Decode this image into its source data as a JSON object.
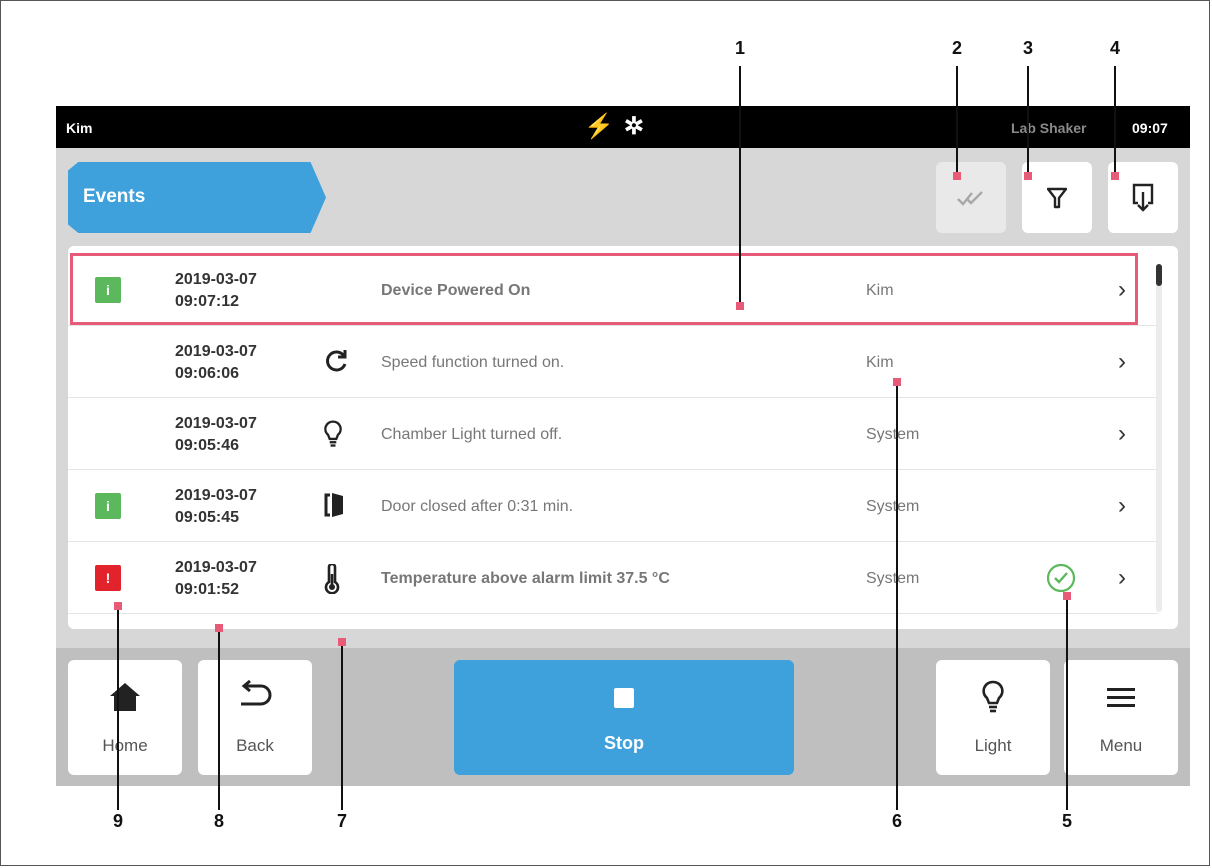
{
  "statusbar": {
    "user": "Kim",
    "device": "Lab Shaker",
    "time": "09:07"
  },
  "header": {
    "title": "Events"
  },
  "toolbar": {
    "acknowledge": {
      "icon": "double-check-icon",
      "enabled": false
    },
    "filter": {
      "icon": "filter-icon"
    },
    "export": {
      "icon": "export-icon"
    }
  },
  "events": [
    {
      "badge": "info",
      "date": "2019-03-07",
      "time": "09:07:12",
      "icon": "",
      "message": "Device Powered On",
      "bold": true,
      "user": "Kim",
      "acknowledged": false
    },
    {
      "badge": "",
      "date": "2019-03-07",
      "time": "09:06:06",
      "icon": "rotation-icon",
      "message": "Speed function turned on.",
      "bold": false,
      "user": "Kim",
      "acknowledged": false
    },
    {
      "badge": "",
      "date": "2019-03-07",
      "time": "09:05:46",
      "icon": "lightbulb-icon",
      "message": "Chamber Light turned off.",
      "bold": false,
      "user": "System",
      "acknowledged": false
    },
    {
      "badge": "info",
      "date": "2019-03-07",
      "time": "09:05:45",
      "icon": "door-icon",
      "message": "Door closed after 0:31 min.",
      "bold": false,
      "user": "System",
      "acknowledged": false
    },
    {
      "badge": "alarm",
      "date": "2019-03-07",
      "time": "09:01:52",
      "icon": "thermometer-icon",
      "message": "Temperature above alarm limit 37.5 °C",
      "bold": true,
      "user": "System",
      "acknowledged": true
    }
  ],
  "bottom": {
    "home": "Home",
    "back": "Back",
    "stop": "Stop",
    "light": "Light",
    "menu": "Menu"
  },
  "callouts": [
    "1",
    "2",
    "3",
    "4",
    "5",
    "6",
    "7",
    "8",
    "9"
  ],
  "colors": {
    "accent": "#3ea1dc",
    "info": "#5cb85c",
    "alarm": "#e2232c",
    "highlight": "#e85b78"
  }
}
